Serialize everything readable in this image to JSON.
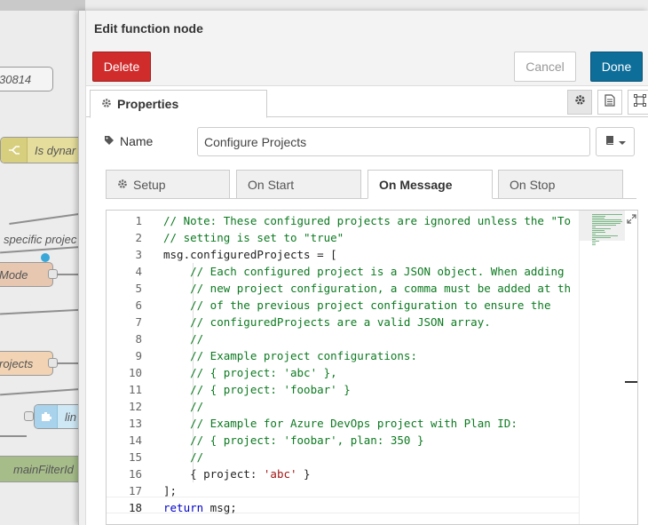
{
  "canvas": {
    "node_30814": "30814",
    "node_dynamic": "Is dynar",
    "text_specific": "specific projec",
    "node_mode": "Mode",
    "node_projects": "rojects",
    "node_link": "lin",
    "node_filter": "mainFilterId"
  },
  "tray": {
    "title": "Edit function node",
    "delete_label": "Delete",
    "cancel_label": "Cancel",
    "done_label": "Done",
    "properties_tab": "Properties",
    "name_label": "Name",
    "name_value": "Configure Projects",
    "tabs": [
      "Setup",
      "On Start",
      "On Message",
      "On Stop"
    ]
  },
  "editor": {
    "line_numbers": [
      "1",
      "2",
      "3",
      "4",
      "5",
      "6",
      "7",
      "8",
      "9",
      "10",
      "11",
      "12",
      "13",
      "14",
      "15",
      "16",
      "17",
      "18"
    ],
    "lines": [
      "// Note: These configured projects are ignored unless the \"To",
      "// setting is set to \"true\"",
      "msg.configuredProjects = [",
      "    // Each configured project is a JSON object. When adding",
      "    // new project configuration, a comma must be added at th",
      "    // of the previous project configuration to ensure the",
      "    // configuredProjects are a valid JSON array.",
      "    //",
      "    // Example project configurations:",
      "    // { project: 'abc' },",
      "    // { project: 'foobar' }",
      "    //",
      "    // Example for Azure DevOps project with Plan ID:",
      "    // { project: 'foobar', plan: 350 }",
      "    //",
      "    { project: ",
      "];",
      " msg;"
    ],
    "line16_string": "'abc'",
    "line16_tail": " }",
    "line18_keyword": "return"
  },
  "colors": {
    "delete": "#d12c2c",
    "done": "#0d6e9a",
    "comment": "#0c7a20",
    "string": "#a31515",
    "keyword": "#0000cc"
  },
  "icons": [
    "cog-icon",
    "tag-icon",
    "book-icon",
    "chevron-down-icon",
    "document-icon",
    "appearance-icon",
    "expand-icon"
  ]
}
